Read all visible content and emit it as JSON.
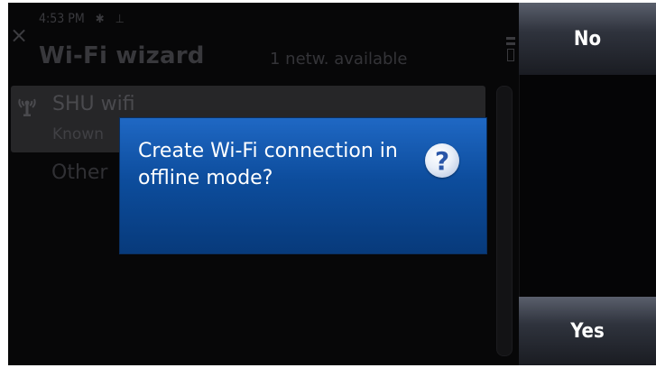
{
  "status": {
    "time": "4:53 PM",
    "icon1": "bluetooth-icon",
    "icon2": "signal-icon"
  },
  "header": {
    "title": "Wi-Fi wizard",
    "network_count": "1 netw. available"
  },
  "list": [
    {
      "name": "SHU wifi",
      "sub": "Known"
    },
    {
      "name": "Other"
    }
  ],
  "dialog": {
    "message": "Create Wi-Fi connection in offline mode?",
    "icon": "question-icon",
    "glyph": "?"
  },
  "softkeys": {
    "no": "No",
    "yes": "Yes"
  }
}
